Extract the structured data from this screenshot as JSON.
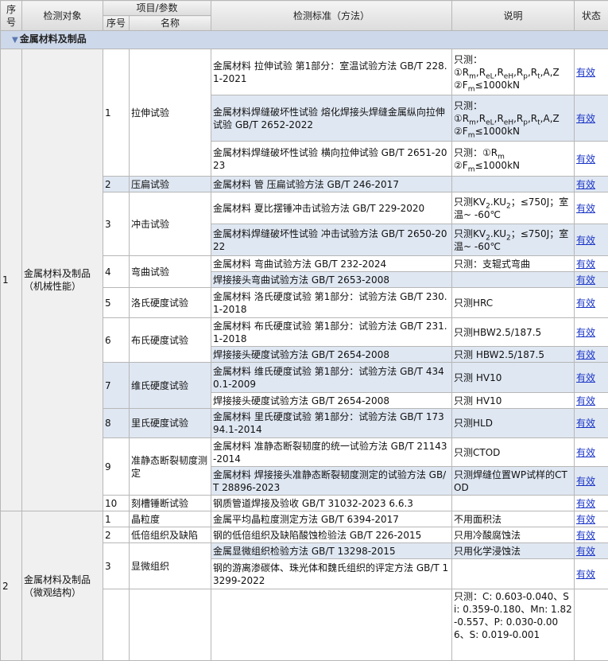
{
  "header": {
    "seq": "序号",
    "object": "检测对象",
    "param": "项目/参数",
    "sub_seq": "序号",
    "name": "名称",
    "standard": "检测标准（方法）",
    "note": "说明",
    "status": "状态"
  },
  "category": "金属材料及制品",
  "groups": [
    {
      "seq": "1",
      "object": "金属材料及制品（机械性能）"
    },
    {
      "seq": "2",
      "object": "金属材料及制品（微观结构）"
    }
  ],
  "status_label": "有效",
  "items": [
    {
      "seq": "1",
      "name": "拉伸试验"
    },
    {
      "seq": "2",
      "name": "压扁试验"
    },
    {
      "seq": "3",
      "name": "冲击试验"
    },
    {
      "seq": "4",
      "name": "弯曲试验"
    },
    {
      "seq": "5",
      "name": "洛氏硬度试验"
    },
    {
      "seq": "6",
      "name": "布氏硬度试验"
    },
    {
      "seq": "7",
      "name": "维氏硬度试验"
    },
    {
      "seq": "8",
      "name": "里氏硬度试验"
    },
    {
      "seq": "9",
      "name": "准静态断裂韧度测定"
    },
    {
      "seq": "10",
      "name": "刻槽锤断试验"
    },
    {
      "seq": "1",
      "name": "晶粒度"
    },
    {
      "seq": "2",
      "name": "低倍组织及缺陷"
    },
    {
      "seq": "3",
      "name": "显微组织"
    }
  ],
  "standards": [
    "金属材料 拉伸试验 第1部分：室温试验方法 GB/T 228.1-2021",
    "金属材料焊缝破坏性试验 熔化焊接头焊缝金属纵向拉伸试验 GB/T 2652-2022",
    "金属材料焊缝破坏性试验 横向拉伸试验 GB/T 2651-2023",
    "金属材料 管 压扁试验方法 GB/T 246-2017",
    "金属材料 夏比摆锤冲击试验方法 GB/T 229-2020",
    "金属材料焊缝破坏性试验 冲击试验方法 GB/T 2650-2022",
    "金属材料 弯曲试验方法 GB/T 232-2024",
    "焊接接头弯曲试验方法 GB/T 2653-2008",
    "金属材料 洛氏硬度试验 第1部分：试验方法 GB/T 230.1-2018",
    "金属材料 布氏硬度试验 第1部分：试验方法 GB/T 231.1-2018",
    "焊接接头硬度试验方法 GB/T 2654-2008",
    "金属材料 维氏硬度试验 第1部分：试验方法 GB/T 4340.1-2009",
    "焊接接头硬度试验方法 GB/T 2654-2008",
    "金属材料 里氏硬度试验 第1部分：试验方法 GB/T 17394.1-2014",
    "金属材料 准静态断裂韧度的统一试验方法 GB/T 21143-2014",
    "金属材料 焊接接头准静态断裂韧度测定的试验方法 GB/T 28896-2023",
    "钢质管道焊接及验收 GB/T 31032-2023 6.6.3",
    "金属平均晶粒度测定方法 GB/T 6394-2017",
    "钢的低倍组织及缺陷酸蚀检验法 GB/T 226-2015",
    "金属显微组织检验方法 GB/T 13298-2015",
    "钢的游离渗碳体、珠光体和魏氏组织的评定方法 GB/T 13299-2022"
  ],
  "notes": {
    "only_measure": "只测：",
    "n1_line1": "①R",
    "n1_subs": [
      "m",
      "eL",
      "eH",
      "p",
      "t"
    ],
    "n1_tail": "A,Z",
    "n_line2": "②F",
    "n_line2_sub": "m",
    "n_line2_tail": "≤1000kN",
    "n3_line1": "只测：①R",
    "n3_line1_sub": "m",
    "impact_pre": "只测KV",
    "impact_sub1": "2",
    "impact_mid": ".KU",
    "impact_sub2": "2",
    "impact_tail": "；≤750J；室温~ -60℃",
    "bend": "只测：支辊式弯曲",
    "hrc": "只测HRC",
    "hbw1": "只测HBW2.5/187.5",
    "hbw2": "只测 HBW2.5/187.5",
    "hv1": "只测 HV10",
    "hv2": "只测 HV10",
    "hld": "只测HLD",
    "ctod": "只测CTOD",
    "ctod2": "只测焊缝位置WP试样的CTOD",
    "grain": "不用面积法",
    "macro": "只用冷酸腐蚀法",
    "micro": "只用化学浸蚀法",
    "chem": "只测：C: 0.603-0.040、Si: 0.359-0.180、Mn: 1.82-0.557、P: 0.030-0.006、S: 0.019-0.001"
  }
}
